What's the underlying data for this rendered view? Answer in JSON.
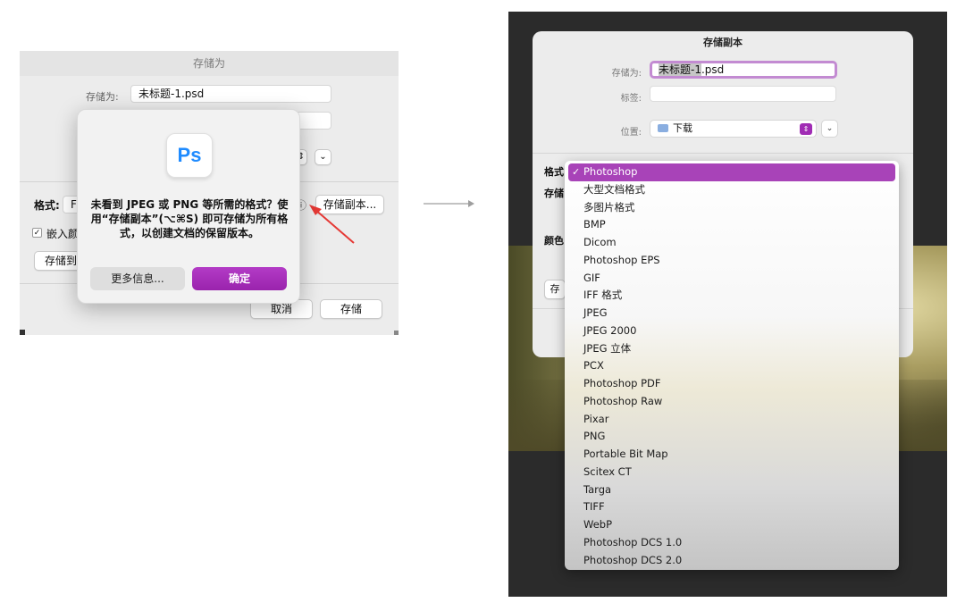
{
  "left": {
    "dialog_title": "存储为",
    "save_as_label": "存储为:",
    "filename": "未标题-1.psd",
    "format_label": "格式:",
    "format_partial": "F",
    "info_icon": "ⓘ",
    "save_copy_button": "存储副本...",
    "embed_checkbox_label": "嵌入颜",
    "save_to_button": "存储到",
    "cancel_button": "取消",
    "save_button": "存储",
    "stepper_glyph": "⇕",
    "expand_glyph": "⌄",
    "arrow_color": "#e53935",
    "alert": {
      "icon_text": "Ps",
      "message": "未看到 JPEG 或 PNG 等所需的格式？使用“存储副本”(⌥⌘S) 即可存储为所有格式，以创建文档的保留版本。",
      "more_info_button": "更多信息...",
      "ok_button": "确定",
      "accent_color": "#a02cb4"
    }
  },
  "right": {
    "dialog_title": "存储副本",
    "save_as_label": "存储为:",
    "filename_selected": "未标题-1",
    "filename_ext": ".psd",
    "tags_label": "标签:",
    "location_label": "位置:",
    "location_value": "下载",
    "format_cut": "格式",
    "storage_cut": "存储",
    "color_cut": "颜色",
    "save_cut": "存",
    "stepper_glyph": "⇕",
    "expand_glyph": "⌄",
    "format_menu": {
      "check_mark": "✓",
      "items": [
        "Photoshop",
        "大型文档格式",
        "多图片格式",
        "BMP",
        "Dicom",
        "Photoshop EPS",
        "GIF",
        "IFF 格式",
        "JPEG",
        "JPEG 2000",
        "JPEG 立体",
        "PCX",
        "Photoshop PDF",
        "Photoshop Raw",
        "Pixar",
        "PNG",
        "Portable Bit Map",
        "Scitex CT",
        "Targa",
        "TIFF",
        "WebP",
        "Photoshop DCS 1.0",
        "Photoshop DCS 2.0"
      ],
      "selected_index": 0,
      "selected_color": "#a843b8"
    }
  }
}
